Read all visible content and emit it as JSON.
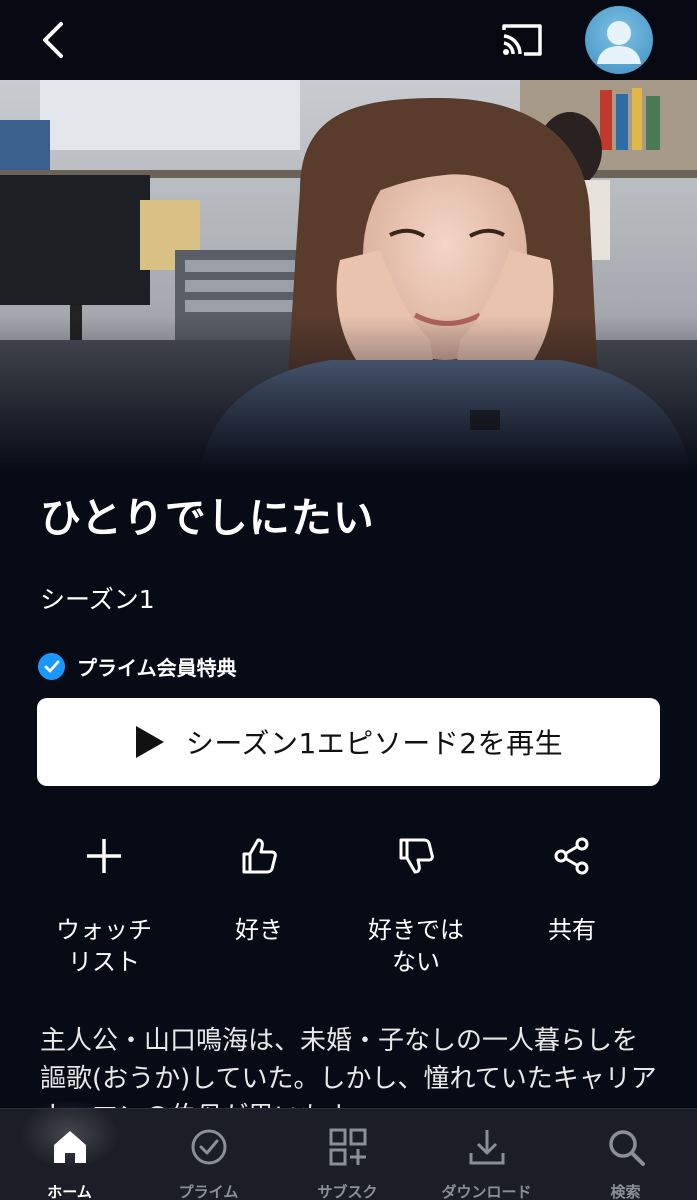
{
  "header": {
    "back_icon": "chevron-left-icon",
    "cast_icon": "cast-icon",
    "avatar_icon": "user-avatar-icon"
  },
  "show": {
    "title": "ひとりでしにたい",
    "season": "シーズン1",
    "prime_badge": "プライム会員特典",
    "play_label": "シーズン1エピソード2を再生"
  },
  "actions": [
    {
      "label": "ウォッチ\nリスト",
      "icon": "plus-icon"
    },
    {
      "label": "好き",
      "icon": "thumbs-up-icon"
    },
    {
      "label": "好きでは\nない",
      "icon": "thumbs-down-icon"
    },
    {
      "label": "共有",
      "icon": "share-icon"
    }
  ],
  "description": "主人公・山口鳴海は、未婚・子なしの一人暮らしを謳歌(おうか)していた。しかし、憧れていたキャリアウーマンの伯母が思いもよ",
  "bottom_nav": [
    {
      "label": "ホーム",
      "icon": "home-icon",
      "active": true
    },
    {
      "label": "プライム",
      "icon": "check-circle-icon",
      "active": false
    },
    {
      "label": "サブスク",
      "icon": "grid-plus-icon",
      "active": false
    },
    {
      "label": "ダウンロード",
      "icon": "download-icon",
      "active": false
    },
    {
      "label": "検索",
      "icon": "search-icon",
      "active": false
    }
  ],
  "colors": {
    "background": "#070b16",
    "accent_blue": "#1a98ff",
    "nav_background": "#1b1e26"
  }
}
